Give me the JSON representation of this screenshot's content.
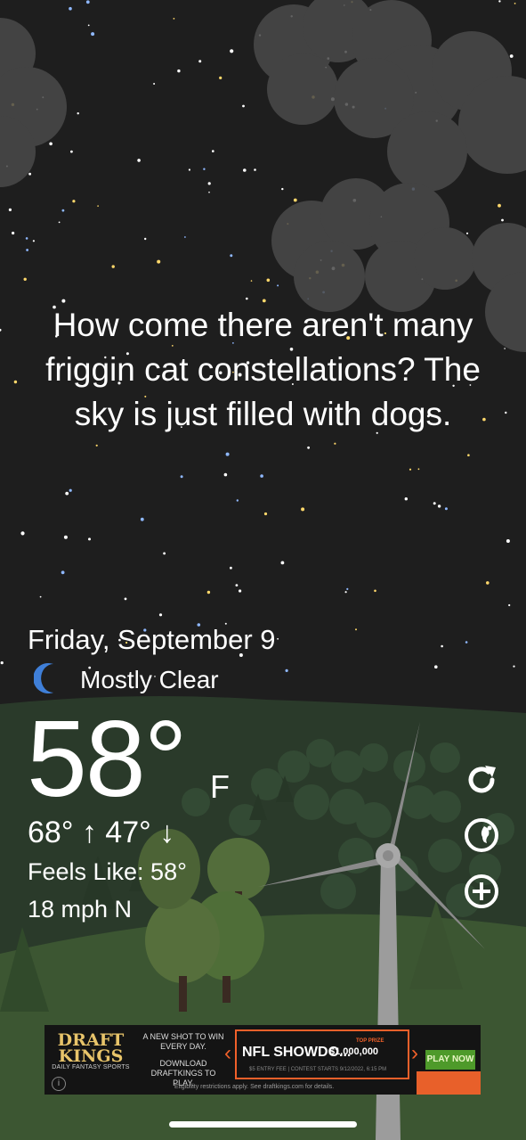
{
  "quote": "How come there aren't many friggin cat constellations? The sky is just filled with dogs.",
  "date": "Friday, September 9",
  "condition": {
    "icon": "crescent-moon-icon",
    "label": "Mostly Clear"
  },
  "temperature": {
    "value": "58°",
    "unit": "F"
  },
  "high_low": "68° ↑  47° ↓",
  "feels_like": "Feels Like: 58°",
  "wind": "18 mph N",
  "controls": [
    "refresh-icon",
    "globe-icon",
    "add-icon"
  ],
  "ad": {
    "brand_top": "DRAFT",
    "brand_bottom": "KINGS",
    "brand_tag": "DAILY FANTASY SPORTS",
    "copy1": "A NEW SHOT TO WIN EVERY DAY.",
    "copy2": "DOWNLOAD DRAFTKINGS TO PLAY.",
    "contest": "NFL SHOWDO...",
    "top_prize_label": "TOP PRIZE",
    "prize": "$1,000,000",
    "fine_print": "$5 ENTRY FEE  |  CONTEST STARTS 9/12/2022, 6:15 PM",
    "cta": "PLAY NOW",
    "eligibility": "Eligibility restrictions apply. See draftkings.com for details."
  },
  "colors": {
    "sky": "#1e1e1e",
    "hill": "#2a3a2a",
    "moon": "#3f7fd8",
    "ad_accent": "#f0602a",
    "ad_cta": "#4e9a2a"
  }
}
